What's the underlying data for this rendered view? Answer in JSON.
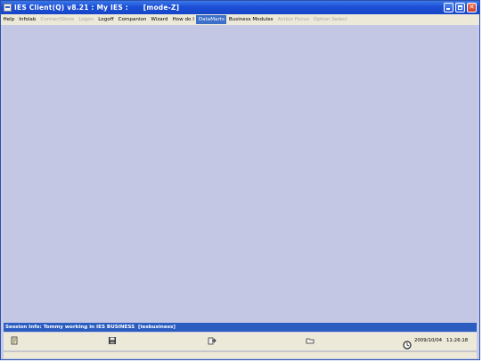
{
  "window": {
    "title": "IES Client(Q) v8.21 : My IES :      [mode-Z]"
  },
  "menubar": {
    "items": [
      {
        "label": "Help",
        "state": "normal"
      },
      {
        "label": "Infolab",
        "state": "normal"
      },
      {
        "label": "ConnectStore",
        "state": "disabled"
      },
      {
        "label": "Logon",
        "state": "disabled"
      },
      {
        "label": "Logoff",
        "state": "normal"
      },
      {
        "label": "Companion",
        "state": "normal"
      },
      {
        "label": "Wizard",
        "state": "normal"
      },
      {
        "label": "How do I",
        "state": "normal"
      },
      {
        "label": "DataMarts",
        "state": "active"
      },
      {
        "label": "Business Modules",
        "state": "normal"
      },
      {
        "label": "Action Focus",
        "state": "disabled"
      },
      {
        "label": "Option Select",
        "state": "disabled"
      }
    ]
  },
  "session": {
    "info": "Session Info: Tommy working in IES BUSINESS  [iesbusiness]"
  },
  "statusbar": {
    "date": "2009/10/04",
    "time": "11:26:18"
  },
  "icons": {
    "toolbar": [
      "notes-icon",
      "save-icon",
      "export-icon",
      "folder-icon",
      "clock-icon"
    ]
  },
  "colors": {
    "titlebar": "#1d4fd6",
    "client_background": "#c3c7e4",
    "session_bar": "#2b5cc0",
    "menu_active": "#3b6fc8"
  }
}
